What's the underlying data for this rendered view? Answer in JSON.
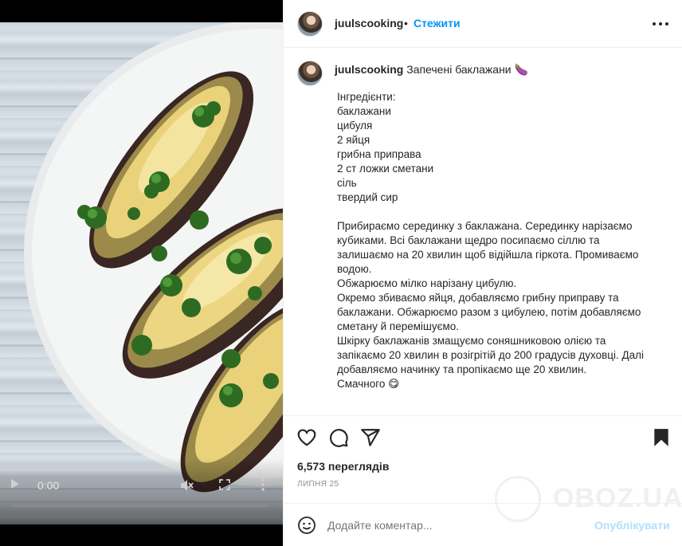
{
  "video": {
    "time": "0:00",
    "progress": 0
  },
  "post": {
    "username": "juulscooking",
    "follow_label": "Стежити",
    "separator": "•",
    "caption_title": "Запечені баклажани 🍆",
    "caption_body": "Інгредієнти:\nбаклажани\nцибуля\n2 яйця\nгрибна приправа\n2 ст ложки сметани\nсіль\nтвердий сир\n\nПрибираємо серединку з баклажана. Серединку нарізаємо кубиками. Всі баклажани щедро посипаємо сіллю та залишаємо на 20 хвилин щоб відійшла гіркота. Промиваємо водою.\nОбжарюємо мілко нарізану цибулю.\nОкремо збиваємо яйця, добавляємо грибну приправу та баклажани. Обжарюємо разом з цибулею, потім добавляємо сметану й перемішуємо.\nШкірку баклажанів змащуємо соняшниковою олією та запікаємо 20 хвилин в розігрітій до 200 градусів духовці. Далі добавляємо начинку та пропікаємо ще 20 хвилин.\nСмачного 😋",
    "views": "6,573 переглядів",
    "date": "липня 25"
  },
  "comment": {
    "placeholder": "Додайте коментар...",
    "post_label": "Опублікувати"
  },
  "watermark": {
    "text": "OBOZ.UA"
  },
  "icons": {
    "like": "heart-icon",
    "comment": "comment-icon",
    "share": "share-icon",
    "save": "bookmark-icon",
    "emoji": "emoji-icon",
    "more": "more-icon"
  },
  "colors": {
    "accent": "#0095f6",
    "post_disabled": "#b2dffc",
    "text": "#262626",
    "muted": "#8e8e8e"
  }
}
